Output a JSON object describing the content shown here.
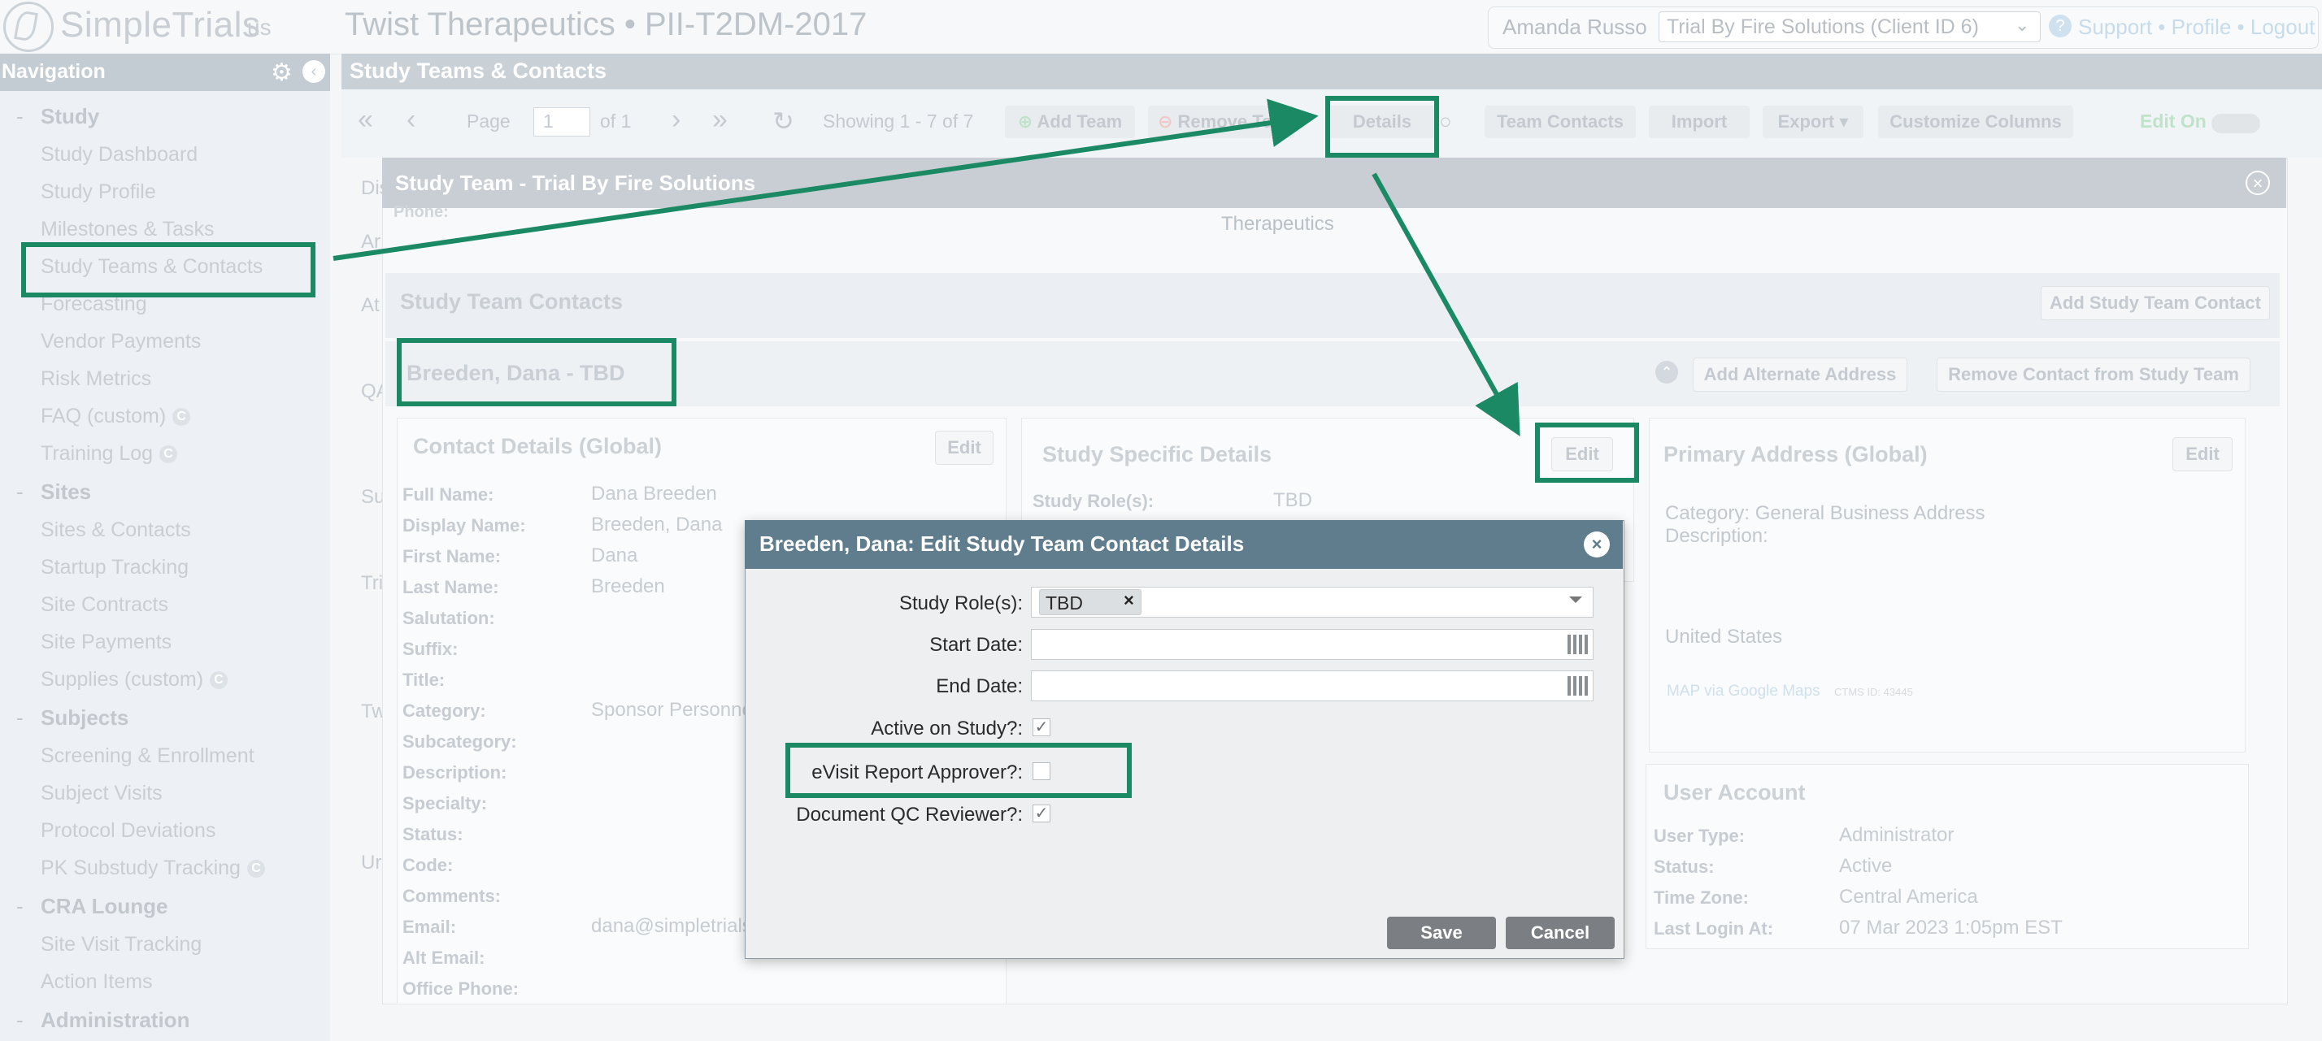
{
  "header": {
    "logo_text": "SimpleTrials",
    "logo_region": "us",
    "study_title": "Twist Therapeutics • PII-T2DM-2017",
    "user_name": "Amanda Russo",
    "client_select": "Trial By Fire Solutions (Client ID 6)",
    "links": "Support • Profile • Logout"
  },
  "sidebar": {
    "title": "Navigation",
    "sections": [
      {
        "label": "Study",
        "items": [
          "Study Dashboard",
          "Study Profile",
          "Milestones & Tasks",
          "Study Teams & Contacts",
          "Forecasting",
          "Vendor Payments",
          "Risk Metrics",
          "FAQ (custom)",
          "Training Log"
        ]
      },
      {
        "label": "Sites",
        "items": [
          "Sites & Contacts",
          "Startup Tracking",
          "Site Contracts",
          "Site Payments",
          "Supplies (custom)"
        ]
      },
      {
        "label": "Subjects",
        "items": [
          "Screening & Enrollment",
          "Subject Visits",
          "Protocol Deviations",
          "PK Substudy Tracking"
        ]
      },
      {
        "label": "CRA Lounge",
        "items": [
          "Site Visit Tracking",
          "Action Items"
        ]
      },
      {
        "label": "Administration",
        "items": []
      }
    ],
    "custom_badge": "C"
  },
  "main": {
    "title": "Study Teams & Contacts",
    "toolbar": {
      "page_label": "Page",
      "page_value": "1",
      "of_label": "of 1",
      "showing": "Showing 1 - 7 of 7",
      "add_team": "Add Team",
      "remove_team": "Remove Te",
      "details": "Details",
      "team_contacts": "Team Contacts",
      "import": "Import",
      "export": "Export",
      "customize_columns": "Customize Columns",
      "edit_on": "Edit On"
    },
    "left_truncated": [
      "Dis",
      "Ar",
      "At",
      "QA",
      "Su",
      "Tri",
      "Tw",
      "Ur"
    ]
  },
  "team_modal": {
    "title": "Study Team - Trial By Fire Solutions",
    "phone_label": "Phone:",
    "company_fragment": "Therapeutics",
    "section_title": "Study Team Contacts",
    "add_contact_button": "Add Study Team Contact",
    "contact_name": "Breeden, Dana - TBD",
    "add_alt_address_button": "Add Alternate Address",
    "remove_contact_button": "Remove Contact from Study Team",
    "contact_details": {
      "title": "Contact Details (Global)",
      "edit": "Edit",
      "fields": [
        {
          "label": "Full Name:",
          "value": "Dana Breeden"
        },
        {
          "label": "Display Name:",
          "value": "Breeden, Dana"
        },
        {
          "label": "First Name:",
          "value": "Dana"
        },
        {
          "label": "Last Name:",
          "value": "Breeden"
        },
        {
          "label": "Salutation:",
          "value": ""
        },
        {
          "label": "Suffix:",
          "value": ""
        },
        {
          "label": "Title:",
          "value": ""
        },
        {
          "label": "Category:",
          "value": "Sponsor Personne"
        },
        {
          "label": "Subcategory:",
          "value": ""
        },
        {
          "label": "Description:",
          "value": ""
        },
        {
          "label": "Specialty:",
          "value": ""
        },
        {
          "label": "Status:",
          "value": ""
        },
        {
          "label": "Code:",
          "value": ""
        },
        {
          "label": "Comments:",
          "value": ""
        },
        {
          "label": "Email:",
          "value": "dana@simpletrials"
        },
        {
          "label": "Alt Email:",
          "value": ""
        },
        {
          "label": "Office Phone:",
          "value": ""
        }
      ]
    },
    "study_specific": {
      "title": "Study Specific Details",
      "edit": "Edit",
      "role_label": "Study Role(s):",
      "role_value": "TBD"
    },
    "primary_address": {
      "title": "Primary Address (Global)",
      "edit": "Edit",
      "category": "Category: General Business Address",
      "description": "Description:",
      "country": "United States",
      "map_link": "MAP via Google Maps",
      "ctms_id": "CTMS ID: 43445"
    },
    "user_account": {
      "title": "User Account",
      "fields": [
        {
          "label": "User Type:",
          "value": "Administrator"
        },
        {
          "label": "Status:",
          "value": "Active"
        },
        {
          "label": "Time Zone:",
          "value": "Central America"
        },
        {
          "label": "Last Login At:",
          "value": "07 Mar 2023 1:05pm EST"
        }
      ]
    }
  },
  "edit_dialog": {
    "title": "Breeden, Dana: Edit Study Team Contact Details",
    "study_roles_label": "Study Role(s):",
    "study_roles_tag": "TBD",
    "start_date_label": "Start Date:",
    "start_date_value": "",
    "end_date_label": "End Date:",
    "end_date_value": "",
    "active_label": "Active on Study?:",
    "active_checked": true,
    "evisit_label": "eVisit Report Approver?:",
    "evisit_checked": false,
    "docqc_label": "Document QC Reviewer?:",
    "docqc_checked": true,
    "save": "Save",
    "cancel": "Cancel"
  },
  "colors": {
    "annotation": "#1b8a64",
    "dialog_header": "#5f7d8c",
    "dialog_button": "#7b7f83"
  }
}
